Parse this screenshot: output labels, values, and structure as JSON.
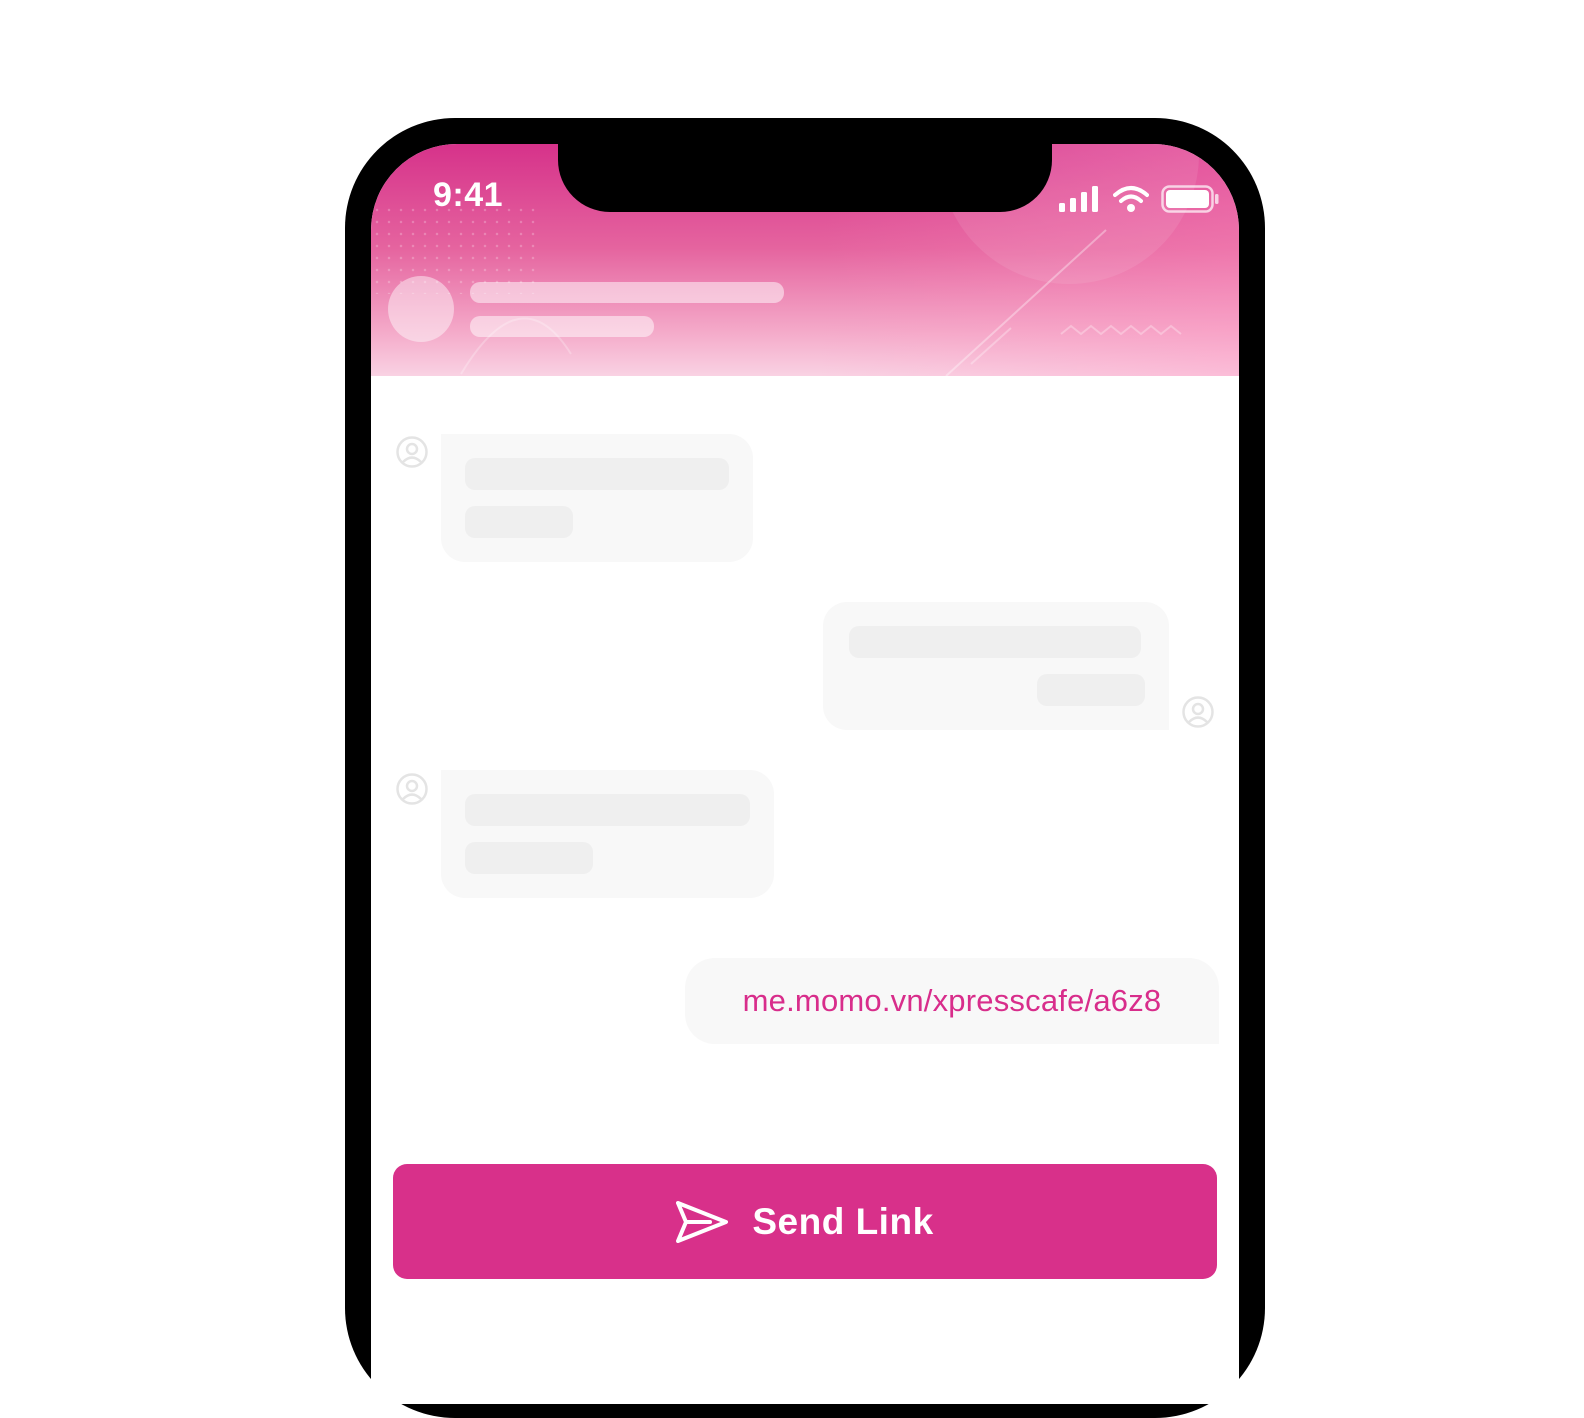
{
  "status_bar": {
    "time": "9:41",
    "icons": [
      "signal-icon",
      "wifi-icon",
      "battery-icon"
    ]
  },
  "chat": {
    "shared_link": "me.momo.vn/xpresscafe/a6z8"
  },
  "actions": {
    "send_label": "Send Link",
    "send_icon": "paper-plane-icon"
  },
  "colors": {
    "brand": "#d8308a",
    "link": "#d82d8b",
    "header_top": "#d6328a",
    "header_bottom": "#f9d2e3",
    "phone_frame": "#000000",
    "bubble": "#f8f8f8",
    "placeholder": "#efefef"
  }
}
